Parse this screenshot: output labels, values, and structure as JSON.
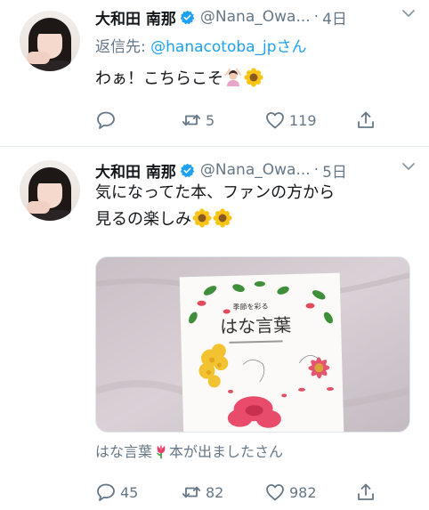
{
  "tweets": [
    {
      "display_name": "大和田 南那",
      "handle": "@Nana_Owa...",
      "dot": "·",
      "time": "4日",
      "reply_prefix": "返信先: ",
      "reply_target": "@hanacotoba_jpさん",
      "text_lines": [
        "わぁ！こちらこそ"
      ],
      "emojis": [
        "person-gesturing-ok-emoji",
        "sunflower-emoji"
      ],
      "replies": "",
      "retweets": "5",
      "likes": "119"
    },
    {
      "display_name": "大和田 南那",
      "handle": "@Nana_Owa...",
      "dot": "·",
      "time": "5日",
      "text_lines": [
        "気になってた本、ファンの方から",
        "見るの楽しみ"
      ],
      "emojis": [
        "sunflower-emoji",
        "sunflower-emoji"
      ],
      "media_caption_before": "はな言葉",
      "media_caption_after": "本が出ましたさん",
      "media_caption_emoji": "tulip-emoji",
      "book": {
        "subtitle": "季節を彩る",
        "title": "はな言葉"
      },
      "replies": "45",
      "retweets": "82",
      "likes": "982"
    }
  ],
  "colors": {
    "accent": "#1da1f2",
    "secondary_text": "#657786",
    "verified": "#1da1f2"
  }
}
